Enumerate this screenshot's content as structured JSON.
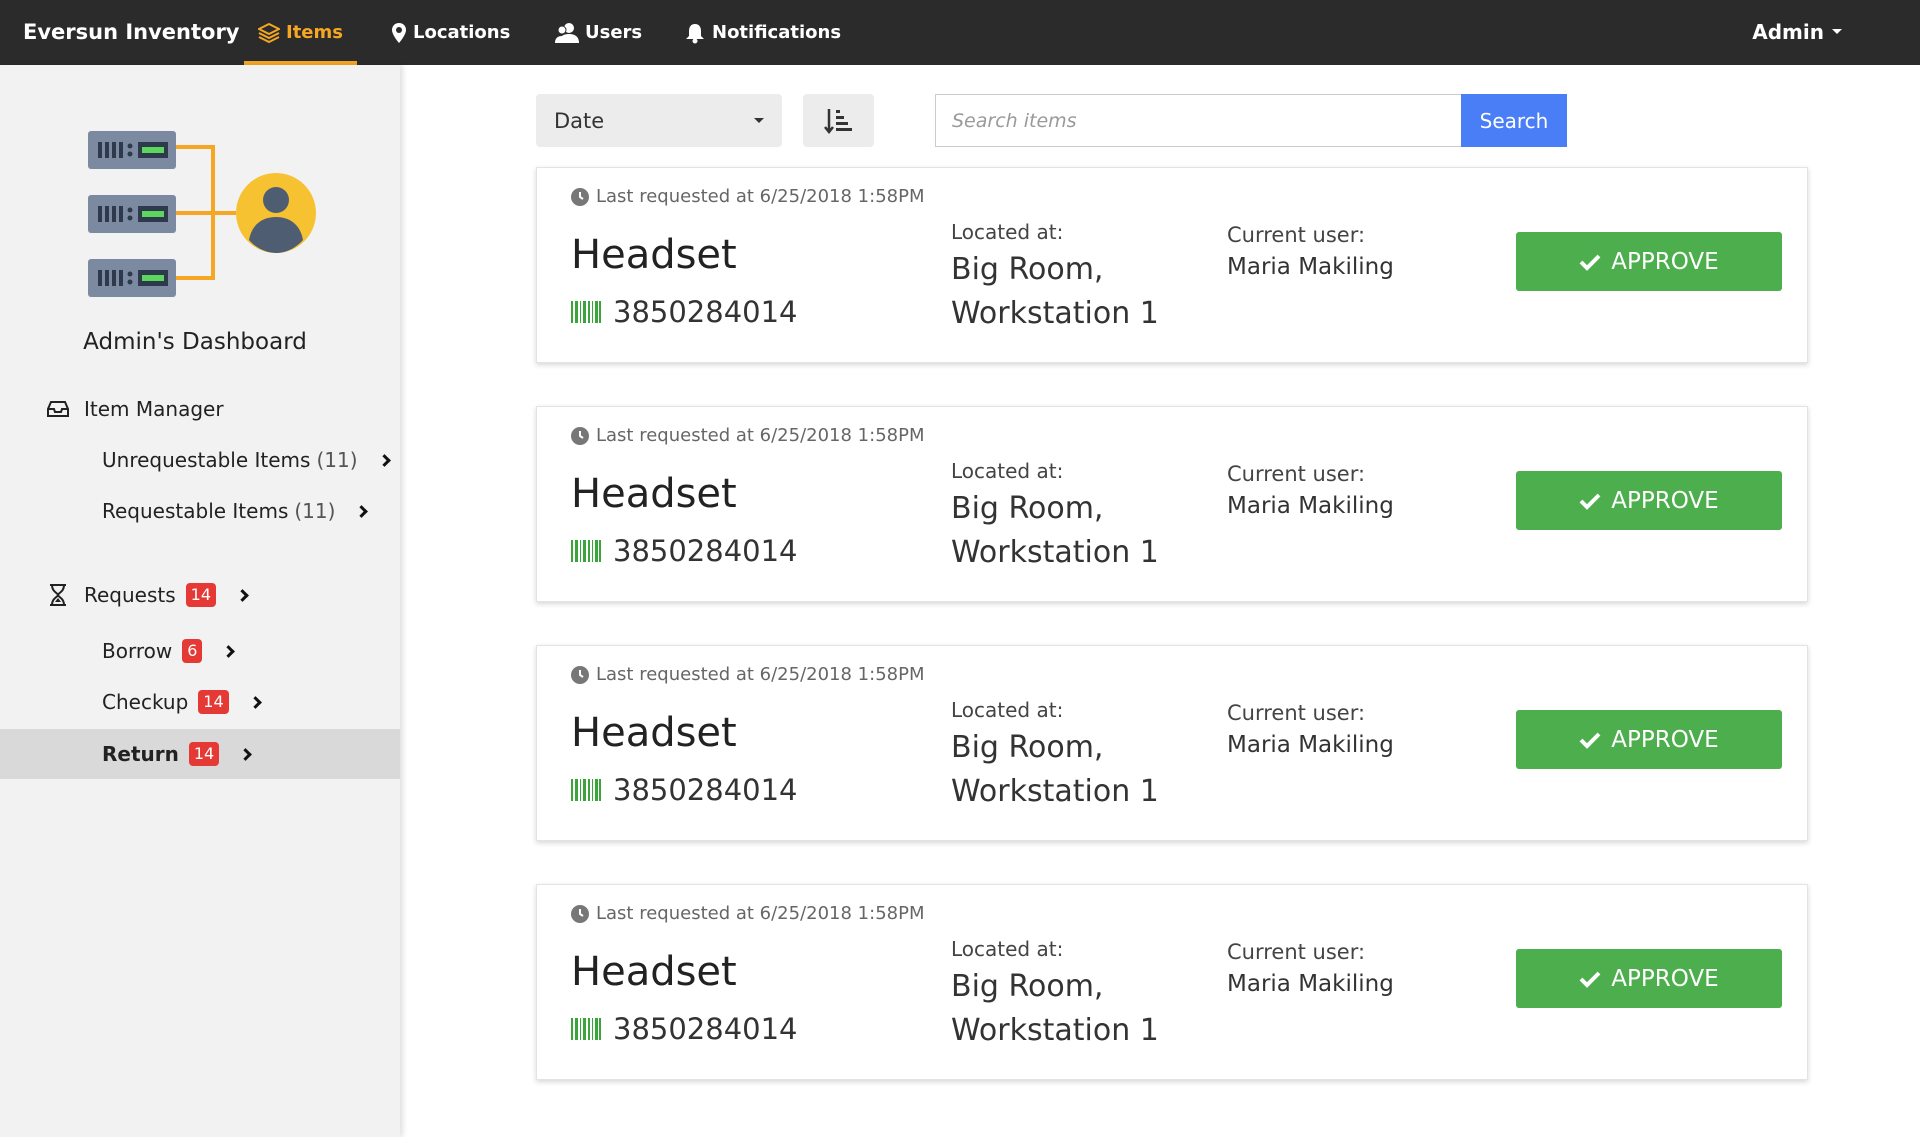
{
  "navbar": {
    "brand": "Eversun Inventory",
    "items": [
      {
        "label": "Items",
        "icon": "layers-icon",
        "active": true
      },
      {
        "label": "Locations",
        "icon": "map-pin-icon",
        "active": false
      },
      {
        "label": "Users",
        "icon": "users-icon",
        "active": false
      },
      {
        "label": "Notifications",
        "icon": "bell-icon",
        "active": false
      }
    ],
    "admin_label": "Admin"
  },
  "sidebar": {
    "title": "Admin's Dashboard",
    "item_manager": {
      "label": "Item Manager",
      "icon": "inbox-icon",
      "children": [
        {
          "label": "Unrequestable Items",
          "count": "(11)"
        },
        {
          "label": "Requestable Items",
          "count": "(11)"
        }
      ]
    },
    "requests": {
      "label": "Requests",
      "icon": "hourglass-icon",
      "badge": "14",
      "children": [
        {
          "label": "Borrow",
          "badge": "6",
          "active": false
        },
        {
          "label": "Checkup",
          "badge": "14",
          "active": false
        },
        {
          "label": "Return",
          "badge": "14",
          "active": true
        }
      ]
    }
  },
  "toolbar": {
    "sort_value": "Date",
    "order_icon": "sort-descending-icon",
    "search_placeholder": "Search items",
    "search_label": "Search"
  },
  "colors": {
    "navbar_bg": "#2b2b2b",
    "accent": "#f5a623",
    "search_button": "#4a7ef7",
    "approve_button": "#4cae4c",
    "badge": "#e53935"
  },
  "cards": [
    {
      "requested": "Last requested at 6/25/2018  1:58PM",
      "name": "Headset",
      "barcode": "3850284014",
      "located_label": "Located at:",
      "location_line1": "Big Room,",
      "location_line2": "Workstation 1",
      "user_label": "Current user:",
      "user": "Maria Makiling",
      "action": "APPROVE"
    },
    {
      "requested": "Last requested at 6/25/2018  1:58PM",
      "name": "Headset",
      "barcode": "3850284014",
      "located_label": "Located at:",
      "location_line1": "Big Room,",
      "location_line2": "Workstation 1",
      "user_label": "Current user:",
      "user": "Maria Makiling",
      "action": "APPROVE"
    },
    {
      "requested": "Last requested at 6/25/2018  1:58PM",
      "name": "Headset",
      "barcode": "3850284014",
      "located_label": "Located at:",
      "location_line1": "Big Room,",
      "location_line2": "Workstation 1",
      "user_label": "Current user:",
      "user": "Maria Makiling",
      "action": "APPROVE"
    },
    {
      "requested": "Last requested at 6/25/2018  1:58PM",
      "name": "Headset",
      "barcode": "3850284014",
      "located_label": "Located at:",
      "location_line1": "Big Room,",
      "location_line2": "Workstation 1",
      "user_label": "Current user:",
      "user": "Maria Makiling",
      "action": "APPROVE"
    }
  ]
}
